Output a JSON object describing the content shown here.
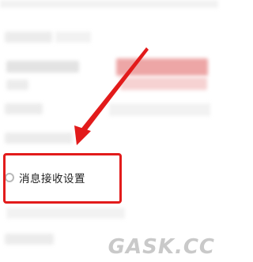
{
  "settings": {
    "message_receive_label": "消息接收设置"
  },
  "annotation": {
    "highlight_color": "#e21b1b",
    "arrow_color": "#e21b1b"
  },
  "watermark": {
    "text": "GASK.CC"
  }
}
